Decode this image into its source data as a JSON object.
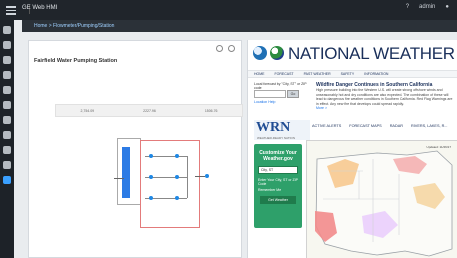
{
  "app": {
    "title": "GE Web HMI",
    "breadcrumb": "Home > Flowmeter/Pumping/Station"
  },
  "left_panel": {
    "station_title": "Fairfield Water Pumping Station",
    "metrics": [
      "2,754.09",
      "2227.96",
      "1506.76"
    ]
  },
  "right_panel": {
    "header": "NATIONAL WEATHER SERV",
    "nav": [
      "HOME",
      "FORECAST",
      "PAST WEATHER",
      "SAFETY",
      "INFORMATION"
    ],
    "location_label": "Local forecast by \"City, ST\" or ZIP code",
    "go_label": "Go",
    "location_help_link": "Location Help",
    "headline": "Wildfire Danger Continues in Southern California",
    "headline_text": "High pressure building into the Western U.S. will create strong offshore winds and unseasonably hot and dry conditions are also expected. The combination of these will lead to dangerous fire weather conditions in Southern California. Red Flag Warnings are in effect. Any new fire that develops could spread rapidly.",
    "headline_more": "More >",
    "wrn_mark": "WRN",
    "wrn_sub": "WEATHER-READY NATION",
    "wrn_nav": [
      "ACTIVE ALERTS",
      "FORECAST MAPS",
      "RADAR",
      "RIVERS, LAKES, R..."
    ],
    "customize_title": "Customize Your Weather.gov",
    "customize_input": "City, ST",
    "customize_note": "Enter Your City, ST or ZIP Code",
    "remember_label": "Remember Me",
    "customize_button": "Get Weather",
    "map_updated": "Updated: 11/26/17"
  },
  "top_right": {
    "user": "admin"
  },
  "colors": {
    "accent": "#3aa0ff",
    "tank": "#2c7be5",
    "nws_blue": "#1a2f5a",
    "green": "#2ea06a"
  }
}
